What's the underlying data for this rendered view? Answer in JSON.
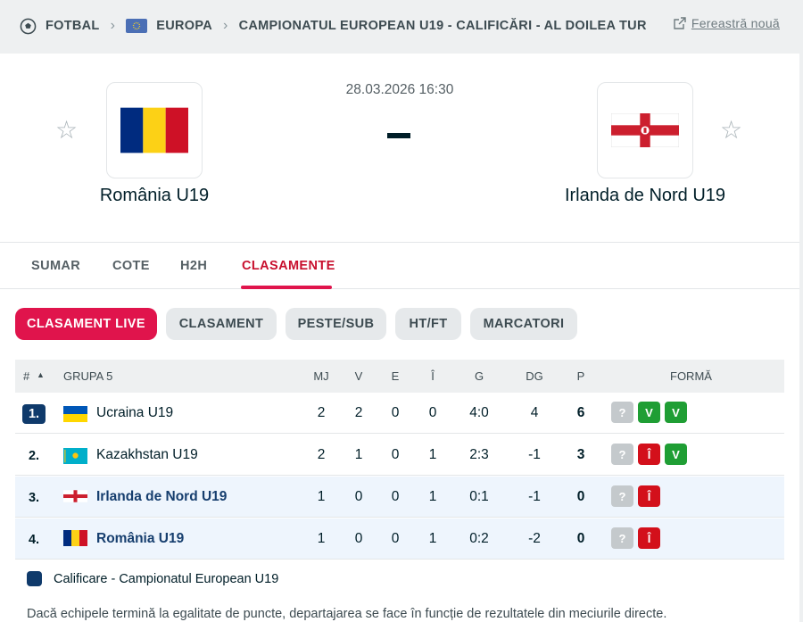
{
  "breadcrumb": {
    "sport": "FOTBAL",
    "region": "EUROPA",
    "competition": "CAMPIONATUL EUROPEAN U19 - CALIFICĂRI - AL DOILEA TUR",
    "new_window": "Fereastră nouă"
  },
  "match": {
    "datetime": "28.03.2026 16:30",
    "score": "-",
    "home": {
      "name": "România U19",
      "flag": "romania"
    },
    "away": {
      "name": "Irlanda de Nord U19",
      "flag": "northern-ireland"
    }
  },
  "tabs": [
    "SUMAR",
    "COTE",
    "H2H",
    "CLASAMENTE"
  ],
  "active_tab": "CLASAMENTE",
  "subtabs": [
    "CLASAMENT LIVE",
    "CLASAMENT",
    "PESTE/SUB",
    "HT/FT",
    "MARCATORI"
  ],
  "active_subtab": "CLASAMENT LIVE",
  "table": {
    "headers": {
      "rank": "#",
      "sort_icon": "▲",
      "group": "GRUPA 5",
      "mj": "MJ",
      "v": "V",
      "e": "E",
      "i": "Î",
      "g": "G",
      "dg": "DG",
      "p": "P",
      "form": "FORMĂ"
    },
    "rows": [
      {
        "rank": "1.",
        "team": "Ucraina U19",
        "flag": "ukraine",
        "mj": "2",
        "v": "2",
        "e": "0",
        "i": "0",
        "g": "4:0",
        "dg": "4",
        "p": "6",
        "form": [
          "?",
          "V",
          "V"
        ]
      },
      {
        "rank": "2.",
        "team": "Kazakhstan U19",
        "flag": "kazakhstan",
        "mj": "2",
        "v": "1",
        "e": "0",
        "i": "1",
        "g": "2:3",
        "dg": "-1",
        "p": "3",
        "form": [
          "?",
          "Î",
          "V"
        ]
      },
      {
        "rank": "3.",
        "team": "Irlanda de Nord U19",
        "flag": "northern-ireland",
        "mj": "1",
        "v": "0",
        "e": "0",
        "i": "1",
        "g": "0:1",
        "dg": "-1",
        "p": "0",
        "form": [
          "?",
          "Î"
        ]
      },
      {
        "rank": "4.",
        "team": "România U19",
        "flag": "romania",
        "mj": "1",
        "v": "0",
        "e": "0",
        "i": "1",
        "g": "0:2",
        "dg": "-2",
        "p": "0",
        "form": [
          "?",
          "Î"
        ]
      }
    ]
  },
  "legend": "Calificare - Campionatul European U19",
  "note": "Dacă echipele termină la egalitate de puncte, departajarea se face în funcție de rezultatele din meciurile directe.",
  "colors": {
    "accent": "#e0144c",
    "qualification": "#0f3a6b",
    "win": "#1f9e34",
    "loss": "#d3101b",
    "unknown": "#c4c9cc"
  }
}
